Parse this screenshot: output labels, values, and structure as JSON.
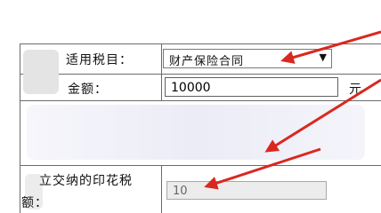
{
  "form": {
    "tax_item_label": "适用税目：",
    "tax_item_value": "财产保险合同",
    "amount_label": "金额：",
    "amount_value": "10000",
    "amount_unit": "元",
    "stamp_tax_label_line1": "立交纳的印花税",
    "stamp_tax_label_line2": "额：",
    "stamp_tax_value": "10"
  },
  "icons": {
    "select_arrow": "dropdown-arrow",
    "annotation": "red-arrow"
  },
  "colors": {
    "annotation_red": "#d9281f",
    "border": "#6b6b6b",
    "readonly_bg": "#ececec"
  }
}
